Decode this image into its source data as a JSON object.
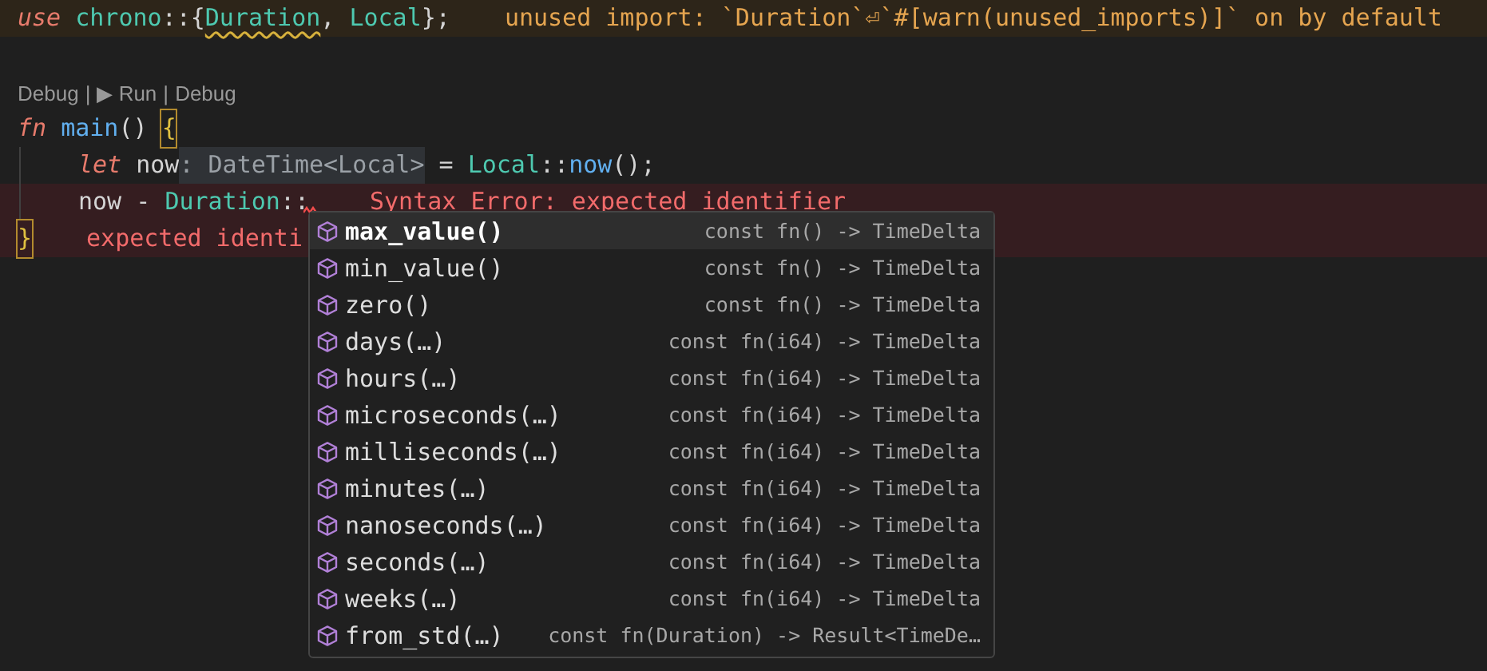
{
  "editor": {
    "lines": [
      {
        "kind": "warning",
        "indent": false,
        "tokens": [
          {
            "text": "use",
            "kind": "keyword"
          },
          {
            "text": " chrono",
            "kind": "module"
          },
          {
            "text": "::{",
            "kind": "punct"
          },
          {
            "text": "Duration",
            "kind": "type",
            "squiggle": true
          },
          {
            "text": ", ",
            "kind": "punct"
          },
          {
            "text": "Local",
            "kind": "type"
          },
          {
            "text": "};",
            "kind": "punct"
          }
        ],
        "diagnostic": "unused import: `Duration`⏎`#[warn(unused_imports)]` on by default"
      },
      {
        "kind": "blank"
      },
      {
        "kind": "codelens",
        "links": [
          "Debug",
          "▶ Run",
          "Debug"
        ],
        "separator": "|"
      },
      {
        "kind": "normal",
        "indent": false,
        "tokens": [
          {
            "text": "fn",
            "kind": "keyword"
          },
          {
            "text": " main",
            "kind": "function"
          },
          {
            "text": "() ",
            "kind": "punct"
          },
          {
            "text": "{",
            "kind": "punct",
            "matched": true
          }
        ]
      },
      {
        "kind": "normal",
        "indent": true,
        "tokens": [
          {
            "text": "let",
            "kind": "keyword"
          },
          {
            "text": " now",
            "kind": "variable"
          },
          {
            "text": ": DateTime<Local>",
            "kind": "hint"
          },
          {
            "text": " = ",
            "kind": "punct"
          },
          {
            "text": "Local",
            "kind": "type"
          },
          {
            "text": "::",
            "kind": "punct"
          },
          {
            "text": "now",
            "kind": "function"
          },
          {
            "text": "();",
            "kind": "punct"
          }
        ]
      },
      {
        "kind": "error",
        "indent": true,
        "tokens": [
          {
            "text": "now",
            "kind": "variable"
          },
          {
            "text": " - ",
            "kind": "punct"
          },
          {
            "text": "Duration",
            "kind": "type"
          },
          {
            "text": "::",
            "kind": "punct"
          }
        ],
        "error_mark": true,
        "diagnostic": "Syntax Error: expected identifier"
      },
      {
        "kind": "error",
        "indent": false,
        "tokens": [
          {
            "text": "}",
            "kind": "punct",
            "matched": true
          }
        ],
        "diagnostic": "expected identi"
      }
    ]
  },
  "completion": {
    "items": [
      {
        "label": "max_value()",
        "detail": "const fn() -> TimeDelta",
        "selected": true
      },
      {
        "label": "min_value()",
        "detail": "const fn() -> TimeDelta",
        "selected": false
      },
      {
        "label": "zero()",
        "detail": "const fn() -> TimeDelta",
        "selected": false
      },
      {
        "label": "days(…)",
        "detail": "const fn(i64) -> TimeDelta",
        "selected": false
      },
      {
        "label": "hours(…)",
        "detail": "const fn(i64) -> TimeDelta",
        "selected": false
      },
      {
        "label": "microseconds(…)",
        "detail": "const fn(i64) -> TimeDelta",
        "selected": false
      },
      {
        "label": "milliseconds(…)",
        "detail": "const fn(i64) -> TimeDelta",
        "selected": false
      },
      {
        "label": "minutes(…)",
        "detail": "const fn(i64) -> TimeDelta",
        "selected": false
      },
      {
        "label": "nanoseconds(…)",
        "detail": "const fn(i64) -> TimeDelta",
        "selected": false
      },
      {
        "label": "seconds(…)",
        "detail": "const fn(i64) -> TimeDelta",
        "selected": false
      },
      {
        "label": "weeks(…)",
        "detail": "const fn(i64) -> TimeDelta",
        "selected": false
      },
      {
        "label": "from_std(…)",
        "detail": "const fn(Duration) -> Result<TimeDe…",
        "selected": false
      }
    ]
  }
}
